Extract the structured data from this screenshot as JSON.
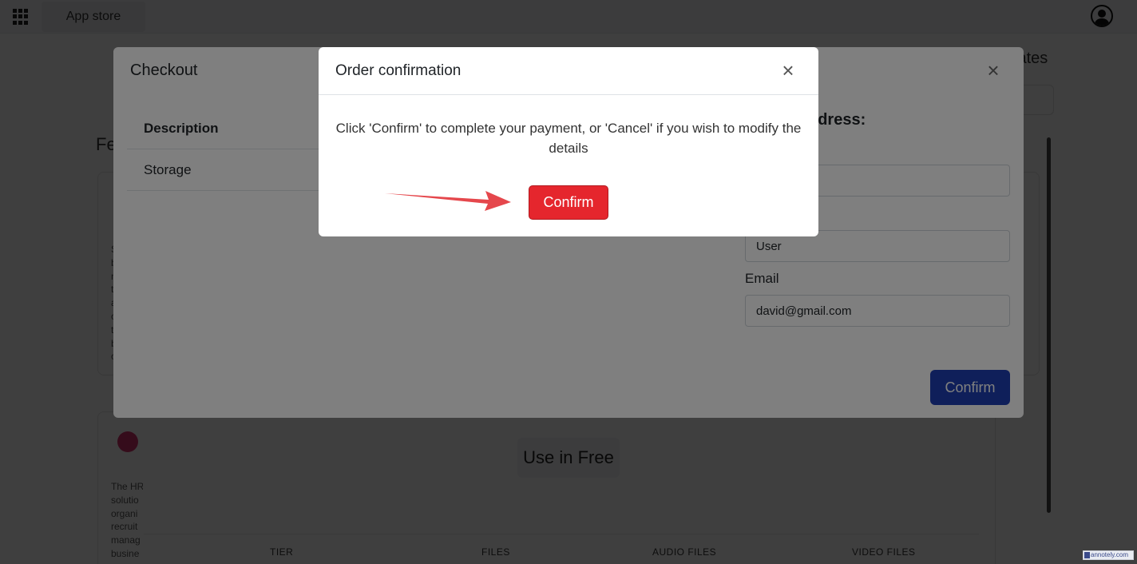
{
  "topbar": {
    "app_store_label": "App store"
  },
  "background": {
    "templates_label": "lates",
    "features_label": "Fe",
    "card1_text": "S\nb\nn\nt\na\nc\nt\nb\nc",
    "card2_text": "The HR\nsolutio\norgani\nrecruit\nmanag\nbusine",
    "use_free_label": "Use in Free",
    "tier_columns": [
      "TIER",
      "FILES",
      "AUDIO FILES",
      "VIDEO FILES"
    ]
  },
  "checkout": {
    "title": "Checkout",
    "close_glyph": "×",
    "summary_rows": [
      "Description",
      "Storage"
    ],
    "address_heading": "ddress:",
    "name_value": "User",
    "email_label": "Email",
    "email_value": "david@gmail.com",
    "confirm_label": "Confirm"
  },
  "order_confirmation": {
    "title": "Order confirmation",
    "close_glyph": "×",
    "message": "Click 'Confirm' to complete your payment, or 'Cancel' if you wish to modify the details",
    "confirm_label": "Confirm"
  },
  "annotation": {
    "arrow_color": "#e5474c"
  },
  "watermark": {
    "text": "annotely.com"
  },
  "colors": {
    "confirm_red": "#e5262d",
    "confirm_blue": "#1e3fb4"
  }
}
